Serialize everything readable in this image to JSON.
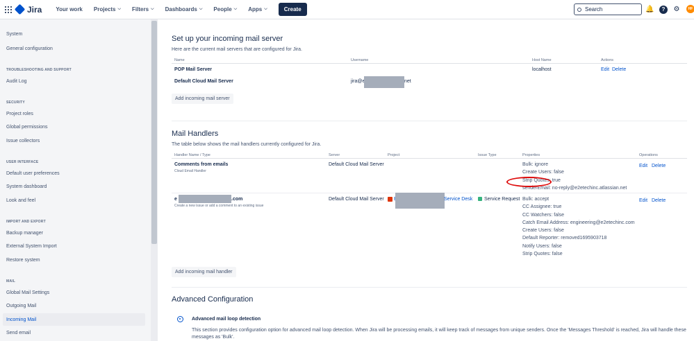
{
  "topbar": {
    "app_name": "Jira",
    "nav": [
      {
        "label": "Your work",
        "chevron": false
      },
      {
        "label": "Projects",
        "chevron": true
      },
      {
        "label": "Filters",
        "chevron": true
      },
      {
        "label": "Dashboards",
        "chevron": true
      },
      {
        "label": "People",
        "chevron": true
      },
      {
        "label": "Apps",
        "chevron": true
      }
    ],
    "create_label": "Create",
    "search_placeholder": "Search",
    "avatar_initials": "HF"
  },
  "sidebar": {
    "top_items": [
      "System",
      "General configuration"
    ],
    "sections": [
      {
        "heading": "TROUBLESHOOTING AND SUPPORT",
        "items": [
          "Audit Log"
        ]
      },
      {
        "heading": "SECURITY",
        "items": [
          "Project roles",
          "Global permissions",
          "Issue collectors"
        ]
      },
      {
        "heading": "USER INTERFACE",
        "items": [
          "Default user preferences",
          "System dashboard",
          "Look and feel"
        ]
      },
      {
        "heading": "IMPORT AND EXPORT",
        "items": [
          "Backup manager",
          "External System Import",
          "Restore system"
        ]
      },
      {
        "heading": "MAIL",
        "items": [
          "Global Mail Settings",
          "Outgoing Mail",
          "Incoming Mail",
          "Send email"
        ]
      }
    ]
  },
  "mail_servers": {
    "title": "Set up your incoming mail server",
    "description": "Here are the current mail servers that are configured for Jira.",
    "columns": [
      "Name",
      "Username",
      "Host Name",
      "Actions"
    ],
    "rows": [
      {
        "name": "POP Mail Server",
        "username": "",
        "host": "localhost",
        "actions": [
          "Edit",
          "Delete"
        ]
      },
      {
        "name": "Default Cloud Mail Server",
        "username_prefix": "jira@e",
        "username_suffix": "net",
        "host": "",
        "actions": []
      }
    ],
    "add_button": "Add incoming mail server"
  },
  "mail_handlers": {
    "title": "Mail Handlers",
    "description": "The table below shows the mail handlers currently configured for Jira.",
    "columns": [
      "Handler Name / Type",
      "Server",
      "Project",
      "Issue Type",
      "Properties",
      "Operations"
    ],
    "rows": [
      {
        "name": "Comments from emails",
        "type": "Cloud Email Handler",
        "server": "Default Cloud Mail Server",
        "project": "",
        "issue_type": "",
        "properties": [
          "Bulk: ignore",
          "Create Users: false",
          "Strip Quotes: true",
          "senderEmail: no-reply@e2etechinc.atlassian.net"
        ],
        "operations": [
          "Edit",
          "Delete"
        ]
      },
      {
        "name_prefix": "e",
        "name_suffix": ".com",
        "type": "Create a new issue or add a comment to an existing issue",
        "server": "Default Cloud Mail Server",
        "project_prefix": "E",
        "project_suffix": "Service Desk",
        "issue_type": "Service Request",
        "properties": [
          "Bulk: accept",
          "CC Assignee: true",
          "CC Watchers: false",
          "Catch Email Address: engineering@e2etechinc.com",
          "Create Users: false",
          "Default Reporter: removed1695903718",
          "Notify Users: false",
          "Strip Quotes: false"
        ],
        "operations": [
          "Edit",
          "Delete"
        ]
      }
    ],
    "add_button": "Add incoming mail handler"
  },
  "advanced": {
    "title": "Advanced Configuration",
    "loop_title": "Advanced mail loop detection",
    "loop_text_1": "This section provides configuration option for advanced mail loop detection. When Jira will be processing emails, it will keep track of messages from unique senders. Once the 'Messages Threshold' is reached, Jira will handle these",
    "loop_text_2": "messages as 'Bulk'."
  },
  "colors": {
    "accent": "#0052cc",
    "highlight_circle": "#de0a0a"
  }
}
